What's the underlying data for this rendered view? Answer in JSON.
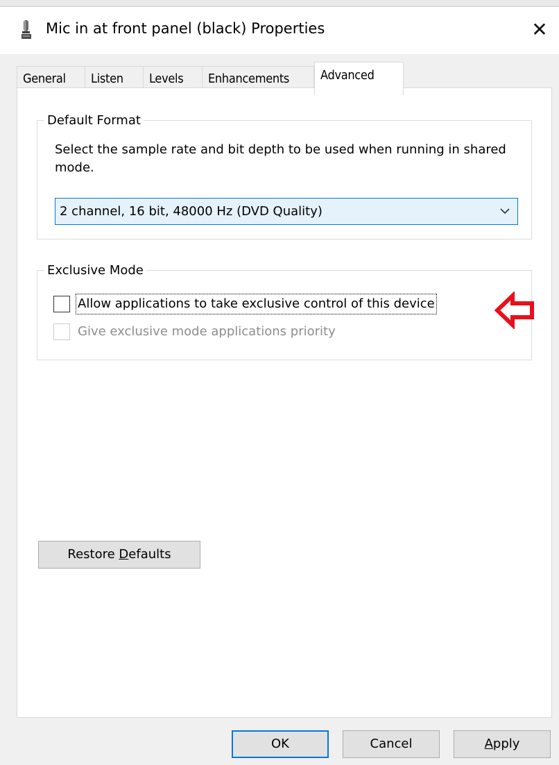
{
  "window": {
    "title": "Mic in at front panel (black) Properties",
    "icon": "microphone-icon",
    "close_glyph": "✕"
  },
  "tabs": [
    {
      "label": "General",
      "active": false
    },
    {
      "label": "Listen",
      "active": false
    },
    {
      "label": "Levels",
      "active": false
    },
    {
      "label": "Enhancements",
      "active": false
    },
    {
      "label": "Advanced",
      "active": true
    }
  ],
  "default_format": {
    "legend": "Default Format",
    "description": "Select the sample rate and bit depth to be used when running in shared mode.",
    "selected": "2 channel, 16 bit, 48000 Hz (DVD Quality)"
  },
  "exclusive_mode": {
    "legend": "Exclusive Mode",
    "allow_exclusive": {
      "label": "Allow applications to take exclusive control of this device",
      "checked": false
    },
    "priority": {
      "label": "Give exclusive mode applications priority",
      "checked": false,
      "enabled": false
    }
  },
  "annotation": {
    "icon": "red-arrow-icon",
    "color": "#e8101b"
  },
  "buttons": {
    "restore_defaults": {
      "pre": "Restore ",
      "access": "D",
      "post": "efaults"
    },
    "ok": "OK",
    "cancel": "Cancel",
    "apply": {
      "access": "A",
      "post": "pply"
    }
  },
  "colors": {
    "accent": "#0078d7",
    "select_bg": "#e5f1fb",
    "window_bg": "#f0f0f0",
    "disabled_text": "#8d8d8d"
  }
}
